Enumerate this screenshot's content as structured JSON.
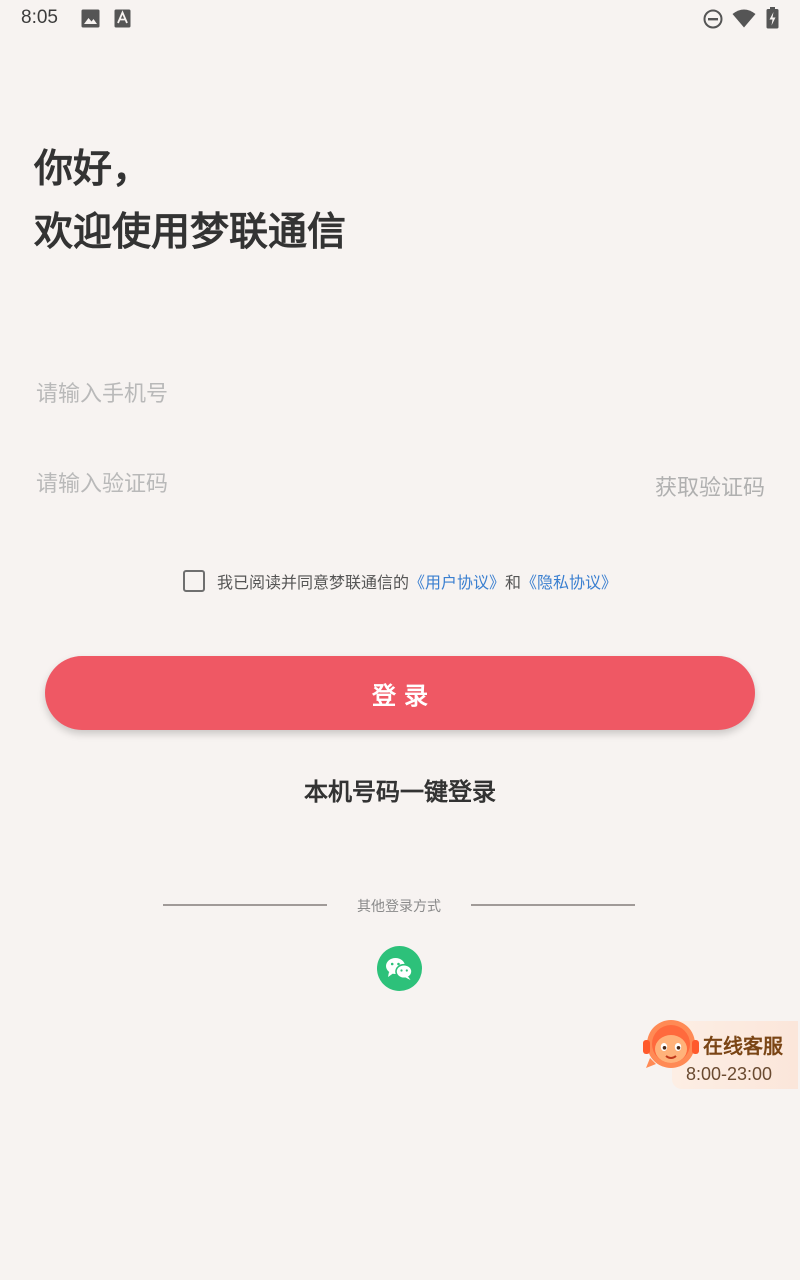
{
  "status_bar": {
    "time": "8:05",
    "left_icons": [
      "image-icon",
      "font-icon"
    ],
    "right_icons": [
      "do-not-disturb-icon",
      "wifi-icon",
      "battery-icon"
    ]
  },
  "greeting": {
    "line1": "你好，",
    "line2": "欢迎使用梦联通信"
  },
  "phone_field": {
    "placeholder": "请输入手机号",
    "value": ""
  },
  "code_field": {
    "placeholder": "请输入验证码",
    "value": "",
    "get_code_label": "获取验证码"
  },
  "agreement": {
    "checked": false,
    "prefix": "我已阅读并同意梦联通信的",
    "user_agreement": "《用户协议》",
    "and": "和",
    "privacy_policy": "《隐私协议》"
  },
  "login_button_label": "登录",
  "one_click_login_label": "本机号码一键登录",
  "other_login": {
    "label": "其他登录方式",
    "methods": [
      "wechat-icon"
    ]
  },
  "customer_service": {
    "title": "在线客服",
    "hours": "8:00-23:00"
  },
  "colors": {
    "background": "#f7f3f1",
    "primary": "#ef5864",
    "link": "#3a7fd0",
    "wechat": "#2dc17a"
  }
}
